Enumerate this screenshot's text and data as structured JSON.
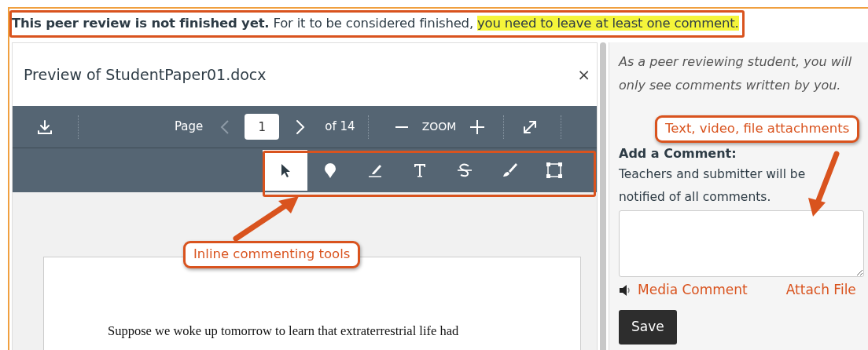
{
  "notice": {
    "text": "**This peer review is not finished yet.** For it to be considered finished, ",
    "highlight": "you need to leave at least one comment."
  },
  "preview": {
    "title": "Preview of StudentPaper01.docx",
    "close": "×"
  },
  "toolbar": {
    "page_label": "Page",
    "prev_disabled": true,
    "page_value": "1",
    "page_count": "of 14",
    "zoom_label": "ZOOM"
  },
  "tools": [
    {
      "kind": "pointer",
      "selected": true
    },
    {
      "kind": "pin",
      "selected": false
    },
    {
      "kind": "highlight",
      "selected": false
    },
    {
      "kind": "text",
      "selected": false
    },
    {
      "kind": "strike",
      "selected": false
    },
    {
      "kind": "draw",
      "selected": false
    },
    {
      "kind": "area",
      "selected": false
    }
  ],
  "document": {
    "text": "Suppose we woke up tomorrow to learn that extraterrestrial life had"
  },
  "sidebar": {
    "intro": "As a peer reviewing student, you will only see comments written by you.",
    "label": "Add a Comment:",
    "help": "Teachers and submitter will be notified of all comments.",
    "media_link": "Media Comment",
    "attach_link": "Attach File",
    "save": "Save"
  },
  "annotations": [
    {
      "text": "Inline commenting tools"
    },
    {
      "text": "Text, video, file attachments"
    }
  ]
}
